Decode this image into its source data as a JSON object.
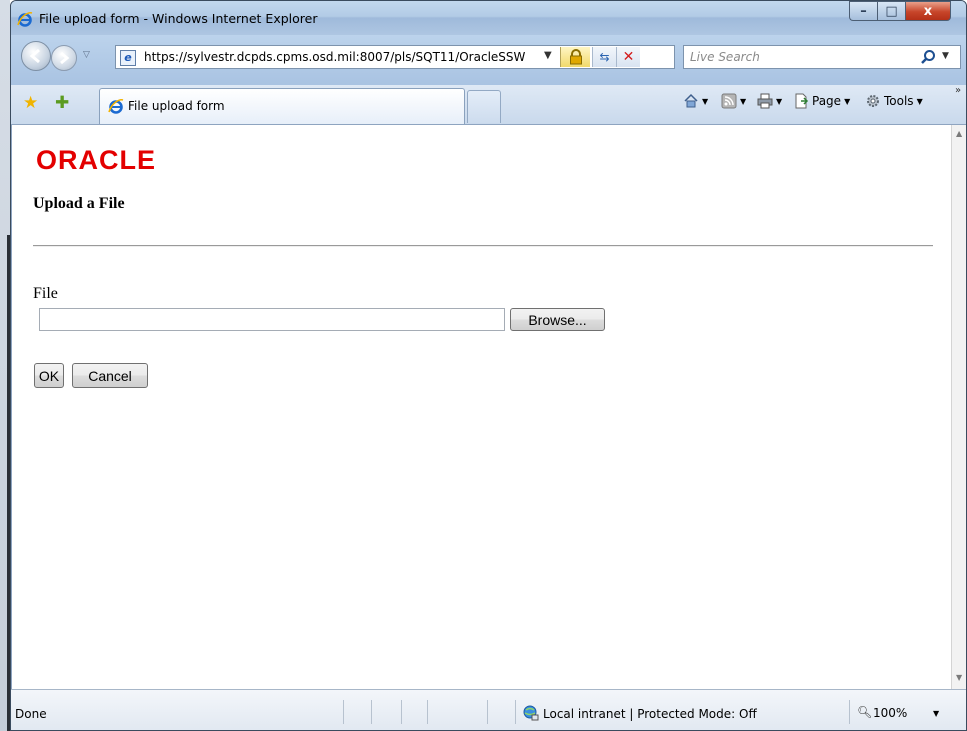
{
  "window": {
    "title": "File upload form - Windows Internet Explorer",
    "controls": {
      "minimize": "–",
      "maximize": "□",
      "close": "x"
    }
  },
  "address_bar": {
    "url": "https://sylvestr.dcpds.cpms.osd.mil:8007/pls/SQT11/OracleSSW",
    "search_placeholder": "Live Search"
  },
  "tabs": [
    {
      "label": "File upload form"
    }
  ],
  "command_bar": {
    "page_label": "Page",
    "tools_label": "Tools",
    "overflow": "»"
  },
  "page": {
    "logo_text": "ORACLE",
    "heading": "Upload a File",
    "file_label": "File",
    "file_value": "",
    "browse_label": "Browse...",
    "ok_label": "OK",
    "cancel_label": "Cancel"
  },
  "status_bar": {
    "status_text": "Done",
    "zone_text": "Local intranet | Protected Mode: Off",
    "zoom_text": "100%"
  },
  "colors": {
    "oracle_red": "#e30000",
    "close_button": "#c7452a"
  }
}
